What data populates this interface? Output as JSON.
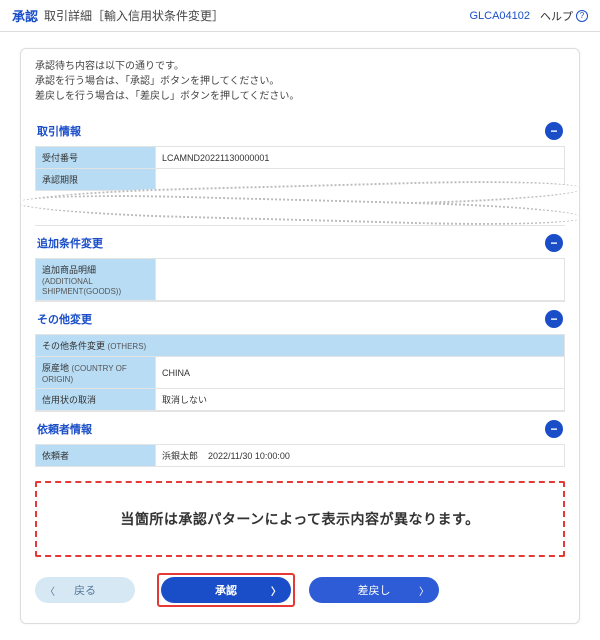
{
  "header": {
    "title": "承認",
    "subtitle": "取引詳細［輸入信用状条件変更］",
    "code": "GLCA04102",
    "help": "ヘルプ"
  },
  "instructions": {
    "line1": "承認待ち内容は以下の通りです。",
    "line2": "承認を行う場合は、「承認」ボタンを押してください。",
    "line3": "差戻しを行う場合は、「差戻し」ボタンを押してください。"
  },
  "sections": {
    "transaction": {
      "title": "取引情報",
      "rows": {
        "receiptNoLabel": "受付番号",
        "receiptNoValue": "LCAMND20221130000001",
        "approvalDeadlineLabel": "承認期限"
      }
    },
    "addCond": {
      "title": "追加条件変更",
      "goodsLabel": "追加商品明細",
      "goodsSub": "(ADDITIONAL SHIPMENT(GOODS))"
    },
    "other": {
      "title": "その他変更",
      "subhead": "その他条件変更",
      "subheadEn": "(OTHERS)",
      "originLabel": "原産地",
      "originEn": "(COUNTRY OF ORIGIN)",
      "originValue": "CHINA",
      "cancelLabel": "信用状の取消",
      "cancelValue": "取消しない"
    },
    "requester": {
      "title": "依頼者情報",
      "requesterLabel": "依頼者",
      "requesterName": "浜銀太郎",
      "requesterTime": "2022/11/30 10:00:00"
    }
  },
  "notice": "当箇所は承認パターンによって表示内容が異なります。",
  "buttons": {
    "back": "戻る",
    "approve": "承認",
    "reject": "差戻し"
  }
}
